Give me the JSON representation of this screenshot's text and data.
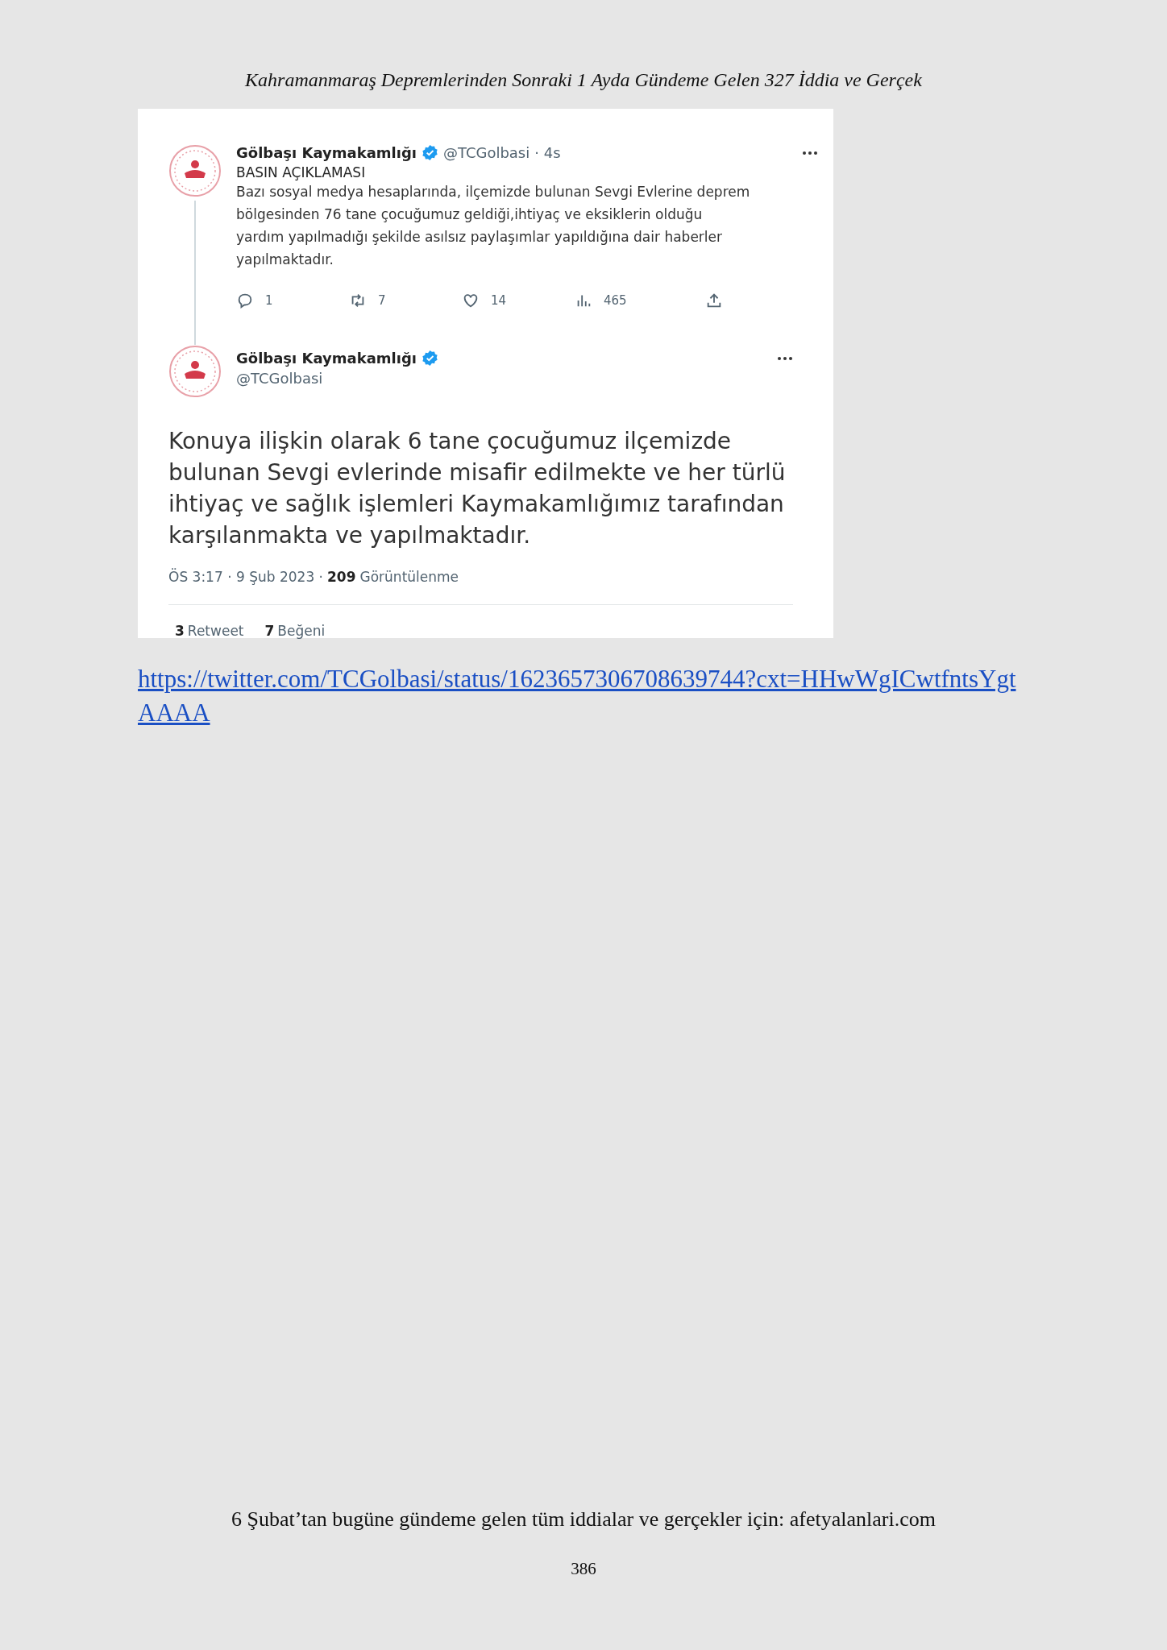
{
  "running_header": "Kahramanmaraş Depremlerinden Sonraki 1 Ayda Gündeme Gelen 327 İddia ve Gerçek",
  "tweets": [
    {
      "kind": "reply_parent",
      "name": "Gölbaşı Kaymakamlığı",
      "verified": true,
      "handle": "@TCGolbasi",
      "time": "· 4s",
      "title": "BASIN AÇIKLAMASI",
      "text": "Bazı sosyal medya hesaplarında, ilçemizde bulunan Sevgi Evlerine deprem bölgesinden 76 tane çocuğumuz geldiği,ihtiyaç ve eksiklerin olduğu yardım yapılmadığı şekilde asılsız paylaşımlar yapıldığına dair haberler yapılmaktadır.",
      "actions": [
        {
          "kind": "reply",
          "count": "1"
        },
        {
          "kind": "retweet",
          "count": "7"
        },
        {
          "kind": "like",
          "count": "14"
        },
        {
          "kind": "views",
          "count": "465"
        },
        {
          "kind": "share"
        }
      ]
    },
    {
      "kind": "main",
      "name": "Gölbaşı Kaymakamlığı",
      "verified": true,
      "handle": "@TCGolbasi",
      "text": "Konuya ilişkin olarak 6 tane çocuğumuz ilçemizde bulunan Sevgi evlerinde misafir edilmekte ve her türlü ihtiyaç ve sağlık işlemleri Kaymakamlığımız tarafından karşılanmakta ve yapılmaktadır.",
      "timestamp": "ÖS 3:17 · 9 Şub 2023 ·",
      "views_count": "209",
      "views_label": "Görüntülenme",
      "stats": [
        {
          "count": "3",
          "label": "Retweet"
        },
        {
          "count": "7",
          "label": "Beğeni"
        }
      ]
    }
  ],
  "link": {
    "line_1": "https://twitter.com/TCGolbasi/status/1623657306708639744?cxt=HHwWgICwtfntsYgt",
    "line_2": "AAAA"
  },
  "footer": "6 Şubat’tan bugüne gündeme gelen tüm iddialar ve gerçekler için: afetyalanlari.com",
  "page_number": "386"
}
